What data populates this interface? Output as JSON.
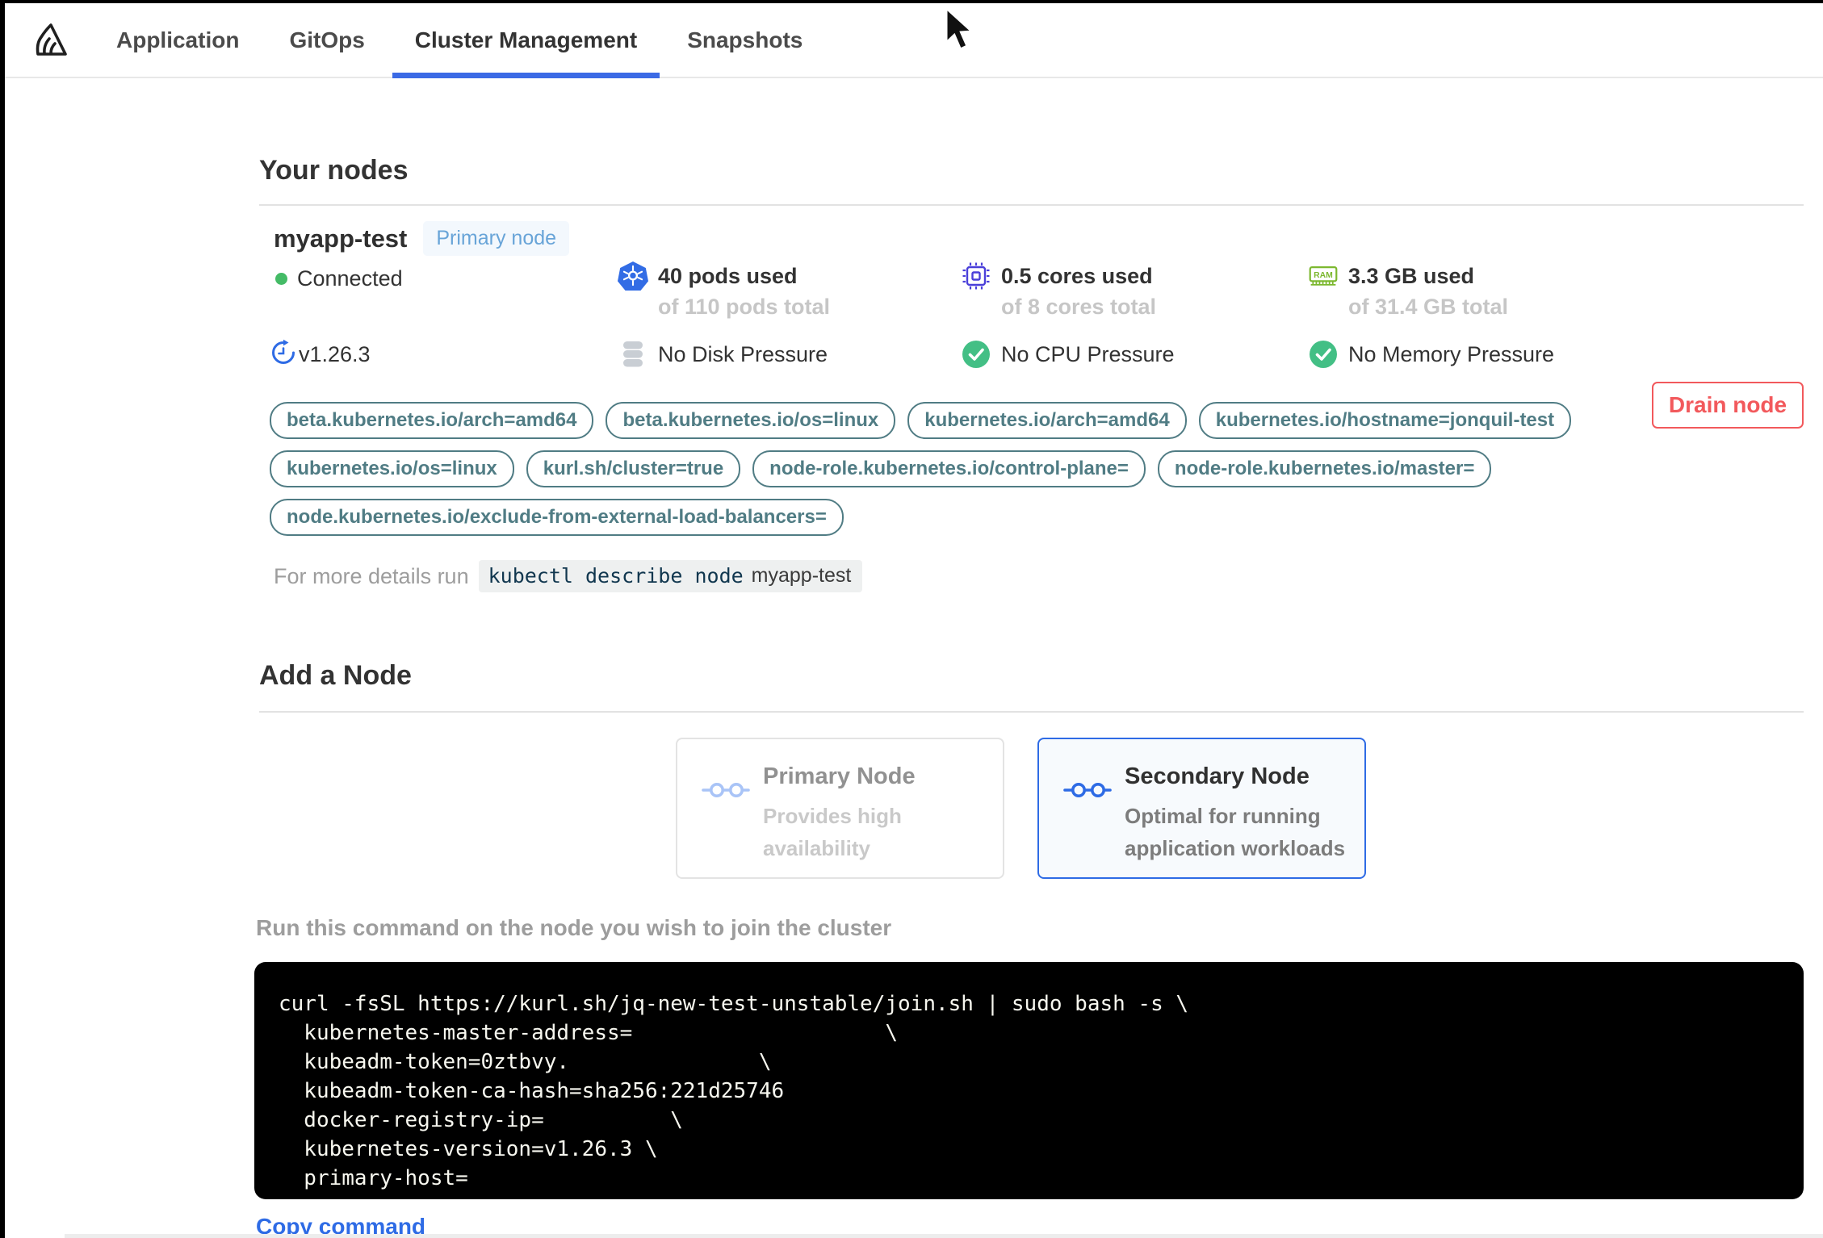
{
  "nav": {
    "tabs": [
      "Application",
      "GitOps",
      "Cluster Management",
      "Snapshots"
    ],
    "active_tab": "Cluster Management"
  },
  "your_nodes": {
    "title": "Your nodes",
    "node": {
      "name": "myapp-test",
      "badge": "Primary node",
      "status": "Connected",
      "version": "v1.26.3",
      "stats": {
        "pods": {
          "main": "40 pods used",
          "sub": "of 110 pods total"
        },
        "cpu": {
          "main": "0.5 cores used",
          "sub": "of 8 cores total"
        },
        "memory": {
          "main": "3.3 GB used",
          "sub": "of 31.4 GB total"
        }
      },
      "conditions": {
        "disk": "No Disk Pressure",
        "cpu": "No CPU Pressure",
        "memory": "No Memory Pressure"
      },
      "labels": [
        "beta.kubernetes.io/arch=amd64",
        "beta.kubernetes.io/os=linux",
        "kubernetes.io/arch=amd64",
        "kubernetes.io/hostname=jonquil-test",
        "kubernetes.io/os=linux",
        "kurl.sh/cluster=true",
        "node-role.kubernetes.io/control-plane=",
        "node-role.kubernetes.io/master=",
        "node.kubernetes.io/exclude-from-external-load-balancers="
      ],
      "details_prefix": "For more details run",
      "details_cmd": "kubectl describe node",
      "details_cmd_arg": "myapp-test",
      "drain_button": "Drain node"
    }
  },
  "add_node": {
    "title": "Add a Node",
    "options": [
      {
        "title": "Primary Node",
        "desc_line1": "Provides high",
        "desc_line2": "availability",
        "state": "disabled"
      },
      {
        "title": "Secondary Node",
        "desc_line1": "Optimal for running",
        "desc_line2": "application workloads",
        "state": "selected"
      }
    ],
    "instruction": "Run this command on the node you wish to join the cluster",
    "command_lines": [
      "curl -fsSL https://kurl.sh/jq-new-test-unstable/join.sh | sudo bash -s \\",
      "  kubernetes-master-address=                    \\",
      "  kubeadm-token=0ztbvy.               \\",
      "  kubeadm-token-ca-hash=sha256:221d25746",
      "  docker-registry-ip=          \\",
      "  kubernetes-version=v1.26.3 \\",
      "  primary-host="
    ],
    "copy_label": "Copy command"
  },
  "colors": {
    "accent_blue": "#2e6be5",
    "kubernetes_blue": "#326ce5",
    "cpu_indigo": "#4a3fd9",
    "ram_green": "#7cb82f",
    "status_green": "#43bf85",
    "connected_green": "#44bb66",
    "label_teal": "#507c84",
    "drain_red": "#f2595c",
    "badge_blue_text": "#68a4d8",
    "badge_blue_bg": "#f3f8fd",
    "terminal_bg": "#000000"
  }
}
